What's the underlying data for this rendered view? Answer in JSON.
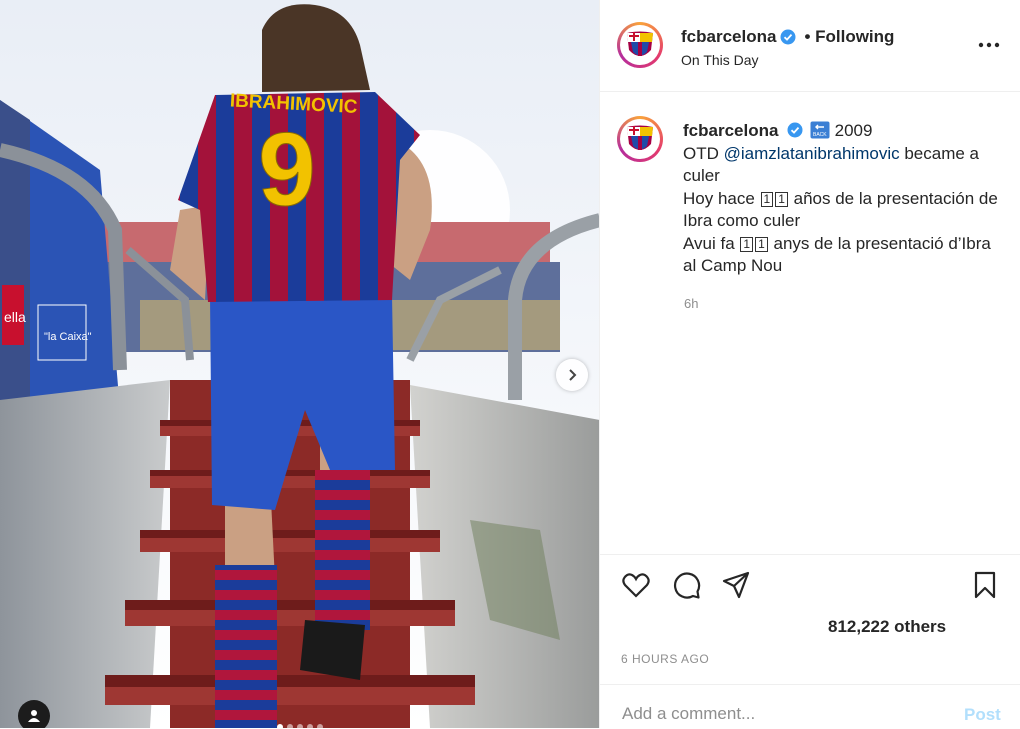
{
  "header": {
    "username": "fcbarcelona",
    "follow_status": "• Following",
    "subtitle": "On This Day",
    "more_icon": "more-horizontal-icon"
  },
  "caption": {
    "username": "fcbarcelona",
    "emoji_label": "BACK",
    "year": "2009",
    "line1_prefix": "OTD ",
    "mention": "@iamzlatanibrahimovic",
    "line1_suffix": " became a culer",
    "line2_prefix": "Hoy hace ",
    "number_box": "1︎⃣1︎⃣",
    "number_box_a": "1",
    "number_box_b": "1",
    "line2_suffix": " años de la presentación de Ibra como culer",
    "line3_prefix": "Avui fa ",
    "line3_suffix": " anys de la presentació d’Ibra al Camp Nou",
    "time": "6h"
  },
  "media": {
    "jersey_name": "IBRAHIMOVIC",
    "jersey_number": "9",
    "sign1": "ella",
    "sign2": "\"la Caixa\"",
    "carousel_count": 5,
    "carousel_active": 1
  },
  "actions": {
    "likes": "812,222 others",
    "time_ago": "6 HOURS AGO"
  },
  "comment": {
    "placeholder": "Add a comment...",
    "post_label": "Post"
  },
  "colors": {
    "blue": "#0095f6",
    "barca_blue": "#1f4aa8",
    "barca_red": "#a50044",
    "gold": "#f2c200"
  }
}
